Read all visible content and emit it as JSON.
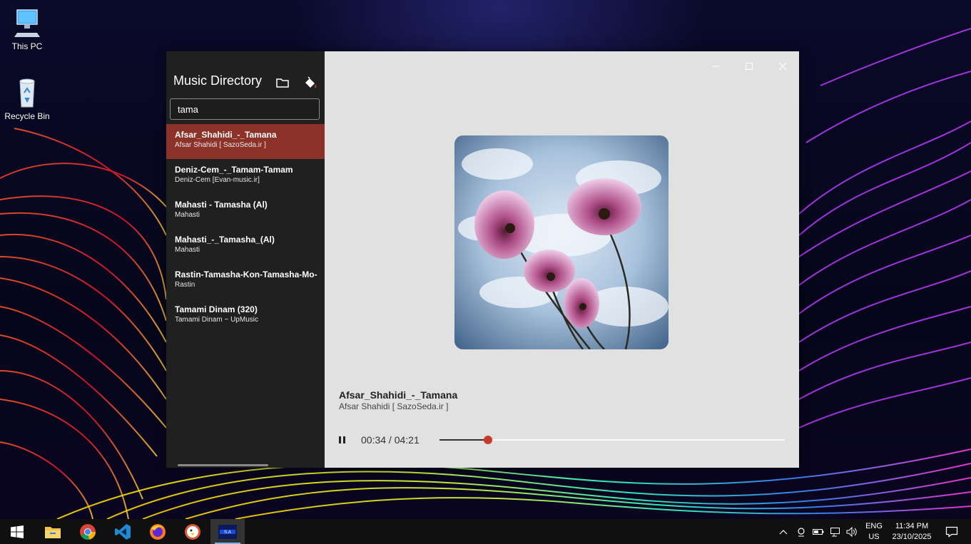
{
  "desktop": {
    "icons": [
      {
        "label": "This PC"
      },
      {
        "label": "Recycle Bin"
      }
    ]
  },
  "app": {
    "sidebar": {
      "title": "Music Directory",
      "search_value": "tama",
      "items": [
        {
          "title": "Afsar_Shahidi_-_Tamana",
          "artist": "Afsar Shahidi [ SazoSeda.ir ]",
          "active": true
        },
        {
          "title": "Deniz-Cem_-_Tamam-Tamam",
          "artist": "Deniz-Cem [Evan-music.ir]"
        },
        {
          "title": "Mahasti - Tamasha (Al)",
          "artist": "Mahasti"
        },
        {
          "title": "Mahasti_-_Tamasha_(Al)",
          "artist": "Mahasti"
        },
        {
          "title": "Rastin-Tamasha-Kon-Tamasha-Mo-",
          "artist": "Rastin"
        },
        {
          "title": "Tamami Dinam (320)",
          "artist": "Tamami Dinam ~ UpMusic"
        }
      ]
    },
    "now_playing": {
      "title": "Afsar_Shahidi_-_Tamana",
      "artist": "Afsar Shahidi [ SazoSeda.ir ]",
      "time": "00:34 / 04:21",
      "progress": 0.14
    },
    "accent_color": "#8c3228",
    "thumb_color": "#c9382a"
  },
  "taskbar": {
    "apps": [
      "windows-start",
      "file-explorer",
      "chrome",
      "vs-code",
      "firefox",
      "duckduckgo",
      "music-app"
    ],
    "language": {
      "line1": "ENG",
      "line2": "US"
    },
    "clock": {
      "time": "11:34 PM",
      "date": "23/10/2025"
    }
  }
}
